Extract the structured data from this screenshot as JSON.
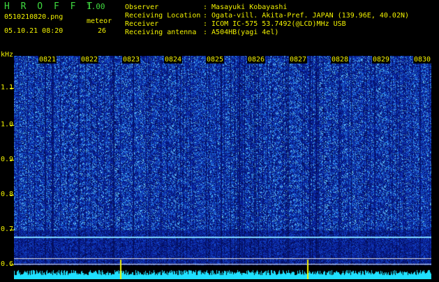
{
  "app": {
    "title": "H R O F F T",
    "version": "1.00"
  },
  "file": {
    "name": "0510210820.png",
    "datetime": "05.10.21 08:20"
  },
  "meteor": {
    "label": "meteor",
    "count": "26"
  },
  "info": [
    {
      "label": "Observer",
      "value": ": Masayuki Kobayashi"
    },
    {
      "label": "Receiving Location",
      "value": ": Ogata-vill. Akita-Pref. JAPAN (139.96E, 40.02N)"
    },
    {
      "label": "Receiver",
      "value": ": ICOM IC-575 53.7492(@LCD)MHz USB"
    },
    {
      "label": "Receiving antenna",
      "value": ": A504HB(yagi 4el)"
    }
  ],
  "axis": {
    "unit": "kHz",
    "y_ticks": [
      "1.1",
      "1.0",
      "0.9",
      "0.8",
      "0.7",
      "0.6"
    ],
    "x_ticks": [
      "0821",
      "0822",
      "0823",
      "0824",
      "0825",
      "0826",
      "0827",
      "0828",
      "0829",
      "0830"
    ]
  },
  "colors": {
    "label": "#f2f200",
    "accent": "#3fd93f",
    "background": "#000000",
    "spectrum": "#0a1f9a"
  }
}
